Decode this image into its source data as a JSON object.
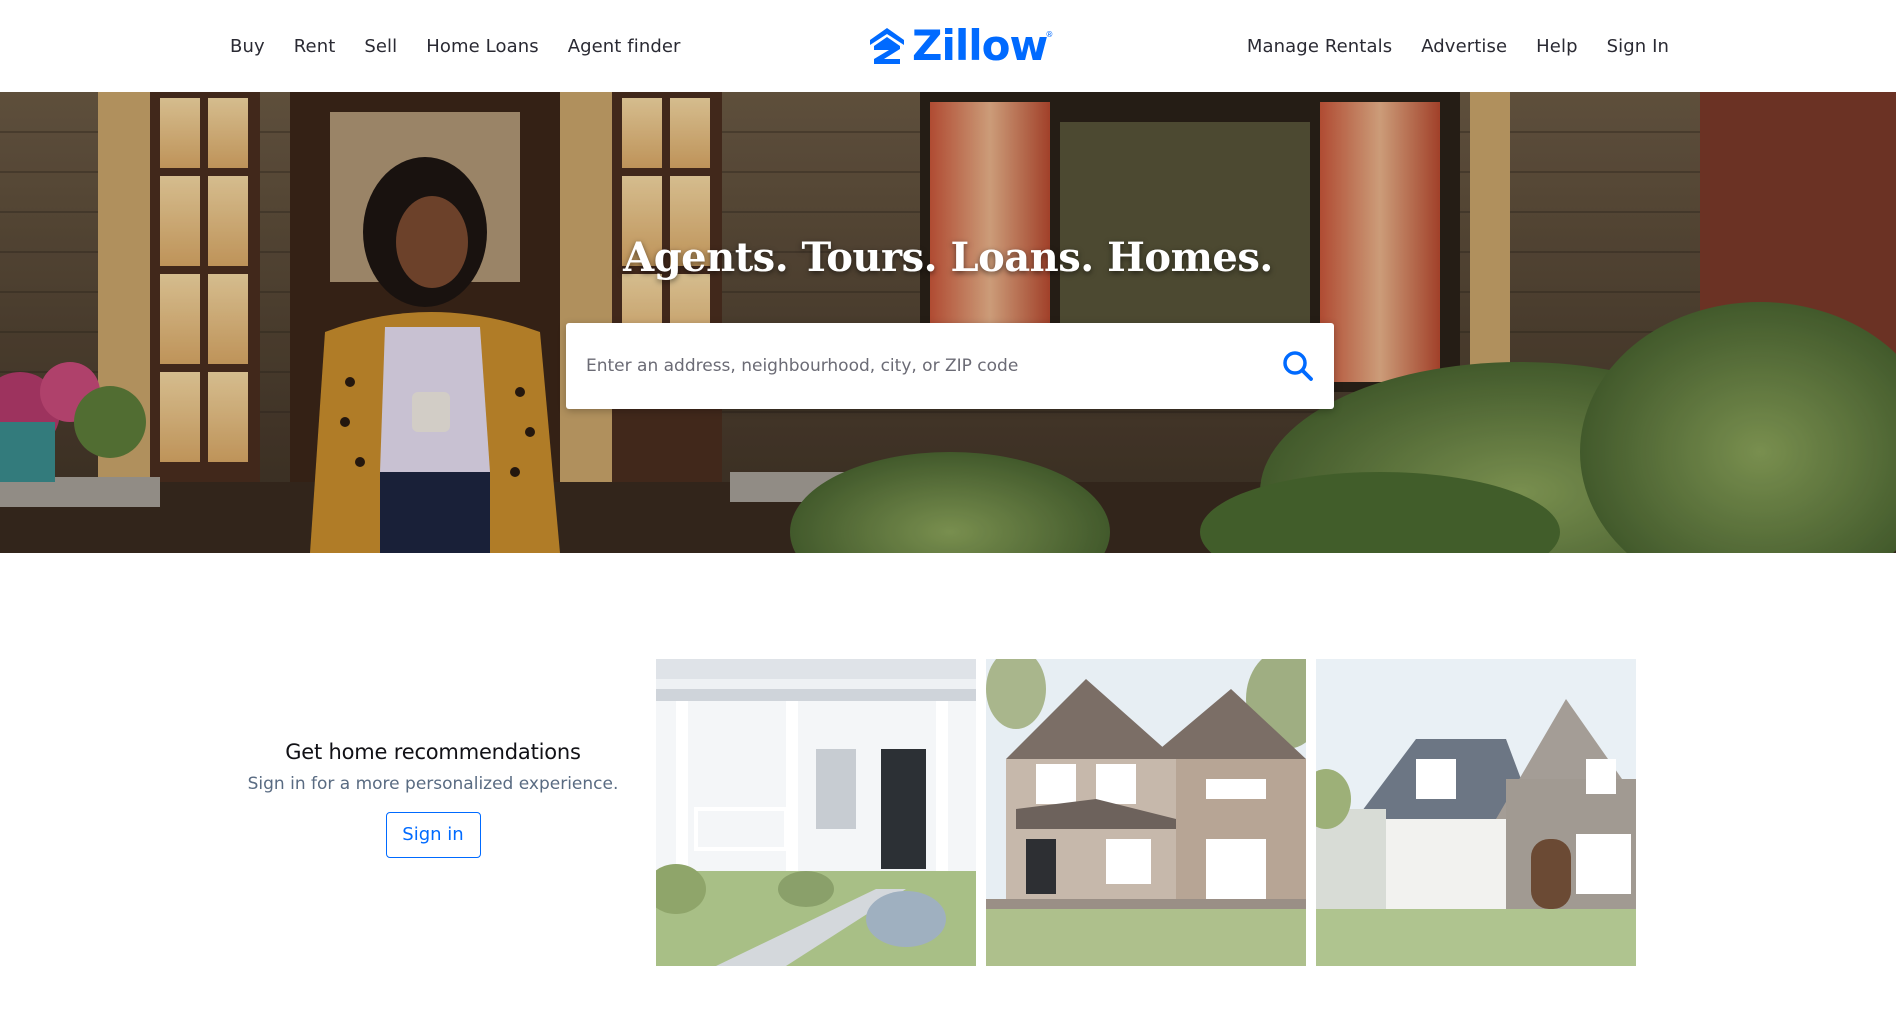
{
  "header": {
    "nav_left": [
      "Buy",
      "Rent",
      "Sell",
      "Home Loans",
      "Agent finder"
    ],
    "nav_right": [
      "Manage Rentals",
      "Advertise",
      "Help",
      "Sign In"
    ],
    "logo_text": "Zillow",
    "logo_mark": "®"
  },
  "hero": {
    "headline": "Agents. Tours. Loans. Homes.",
    "search_placeholder": "Enter an address, neighbourhood, city, or ZIP code",
    "search_icon": "search-icon"
  },
  "recommendations": {
    "title": "Get home recommendations",
    "subtitle": "Sign in for a more personalized experience.",
    "button_label": "Sign in"
  },
  "colors": {
    "brand": "#006aff",
    "text": "#2a2a33",
    "muted": "#596b82"
  }
}
